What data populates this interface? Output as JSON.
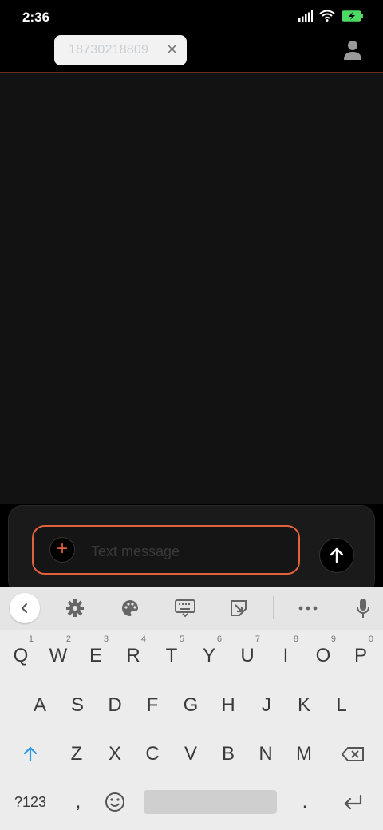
{
  "status_bar": {
    "time": "2:36"
  },
  "header": {
    "recipient_number": "18730218809"
  },
  "composer": {
    "placeholder": "Text message"
  },
  "keyboard": {
    "row1": [
      {
        "letter": "Q",
        "hint": "1"
      },
      {
        "letter": "W",
        "hint": "2"
      },
      {
        "letter": "E",
        "hint": "3"
      },
      {
        "letter": "R",
        "hint": "4"
      },
      {
        "letter": "T",
        "hint": "5"
      },
      {
        "letter": "Y",
        "hint": "6"
      },
      {
        "letter": "U",
        "hint": "7"
      },
      {
        "letter": "I",
        "hint": "8"
      },
      {
        "letter": "O",
        "hint": "9"
      },
      {
        "letter": "P",
        "hint": "0"
      }
    ],
    "row2": [
      "A",
      "S",
      "D",
      "F",
      "G",
      "H",
      "J",
      "K",
      "L"
    ],
    "row3": [
      "Z",
      "X",
      "C",
      "V",
      "B",
      "N",
      "M"
    ],
    "symbols_label": "?123",
    "comma": ",",
    "period": "."
  },
  "colors": {
    "accent": "#e2613d",
    "background": "#121212",
    "keyboard_bg": "#ececec"
  },
  "icons": [
    "signal-icon",
    "wifi-icon",
    "battery-icon",
    "close-icon",
    "contact-icon",
    "add-icon",
    "send-icon",
    "back-icon",
    "settings-icon",
    "palette-icon",
    "keyboard-icon",
    "clipboard-icon",
    "more-icon",
    "mic-icon",
    "shift-icon",
    "backspace-icon",
    "emoji-icon",
    "enter-icon"
  ]
}
